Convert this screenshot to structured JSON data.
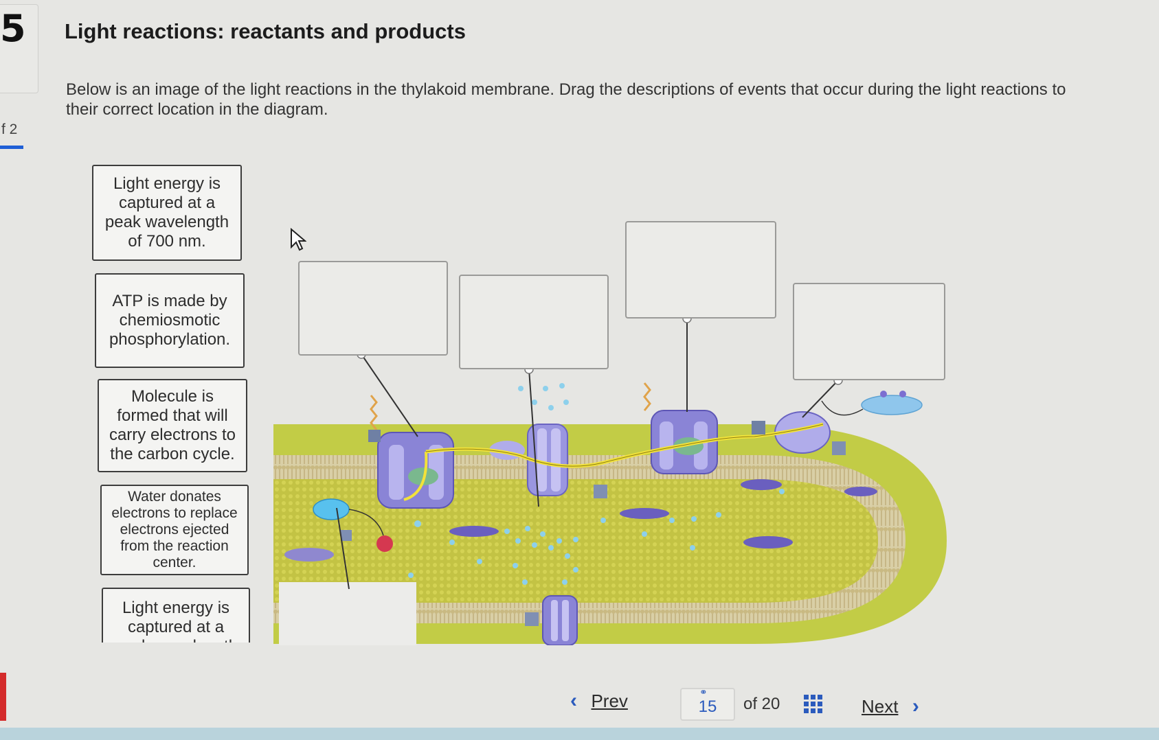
{
  "rail": {
    "number": "5",
    "of_text": "f 2"
  },
  "title": "Light reactions: reactants and products",
  "instructions": "Below is an image of the light reactions in the thylakoid membrane. Drag the descriptions of events that occur during the light reactions to their correct location in the diagram.",
  "cards": [
    {
      "text": "Light energy is captured at a peak wavelength of 700 nm."
    },
    {
      "text": "ATP is made by chemiosmotic phosphorylation."
    },
    {
      "text": "Molecule is formed that will carry electrons to the carbon cycle."
    },
    {
      "text": "Water donates electrons to replace electrons ejected from the reaction center."
    },
    {
      "text": "Light energy is captured at a peak wavelength"
    }
  ],
  "nav": {
    "prev_label": "Prev",
    "page_number": "15",
    "of_label": "of 20",
    "next_label": "Next"
  },
  "icons": [
    "cursor-arrow-icon",
    "chevron-left-icon",
    "link-icon",
    "grid-icon",
    "chevron-right-icon"
  ],
  "colors": {
    "accent": "#2b5bbd",
    "membrane_purple": "#8b84d8",
    "stroma_yellow": "#c8d23a",
    "electron_path": "#f2e23a"
  }
}
